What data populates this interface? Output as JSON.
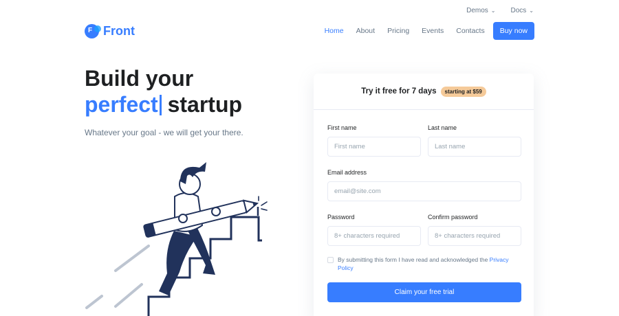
{
  "topbar": {
    "items": [
      {
        "label": "Demos"
      },
      {
        "label": "Docs"
      }
    ]
  },
  "brand": {
    "mark": "F",
    "name": "Front"
  },
  "nav": {
    "items": [
      {
        "label": "Home",
        "active": true
      },
      {
        "label": "About"
      },
      {
        "label": "Pricing"
      },
      {
        "label": "Events"
      },
      {
        "label": "Contacts"
      }
    ],
    "cta": "Buy now"
  },
  "hero": {
    "line1": "Build your",
    "accent_word": "perfect",
    "line2_rest": "startup",
    "subtitle": "Whatever your goal - we will get your there."
  },
  "signup": {
    "title": "Try it free for 7 days",
    "badge": "starting at $59",
    "first_name": {
      "label": "First name",
      "placeholder": "First name"
    },
    "last_name": {
      "label": "Last name",
      "placeholder": "Last name"
    },
    "email": {
      "label": "Email address",
      "placeholder": "email@site.com"
    },
    "password": {
      "label": "Password",
      "placeholder": "8+ characters required"
    },
    "confirm_password": {
      "label": "Confirm password",
      "placeholder": "8+ characters required"
    },
    "consent_text": "By submitting this form I have read and acknowledged the ",
    "consent_link": "Privacy Policy",
    "submit": "Claim your free trial"
  },
  "colors": {
    "primary": "#377dff",
    "badge": "#f5ca99",
    "text": "#1e2022",
    "muted": "#677788",
    "illustration": "#21325b"
  }
}
